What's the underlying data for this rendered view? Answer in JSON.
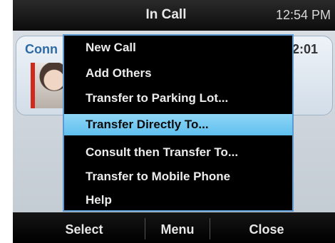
{
  "header": {
    "title": "In Call",
    "time": "12:54 PM"
  },
  "call": {
    "status_partial": "Conn",
    "timer_partial": "2:01"
  },
  "menu": {
    "items": [
      {
        "label": "New Call"
      },
      {
        "label": "Add Others"
      },
      {
        "label": "Transfer to Parking Lot..."
      },
      {
        "label": "Transfer Directly To...",
        "selected": true
      },
      {
        "label": "Consult then Transfer To..."
      },
      {
        "label": "Transfer to Mobile Phone"
      },
      {
        "label": "Help"
      }
    ],
    "highlight_color": "#6ec8f2",
    "border_color": "#5d9ad3"
  },
  "softkeys": {
    "left": "Select",
    "middle": "Menu",
    "right": "Close"
  },
  "colors": {
    "avatar_accent": "#cf2a1c"
  }
}
